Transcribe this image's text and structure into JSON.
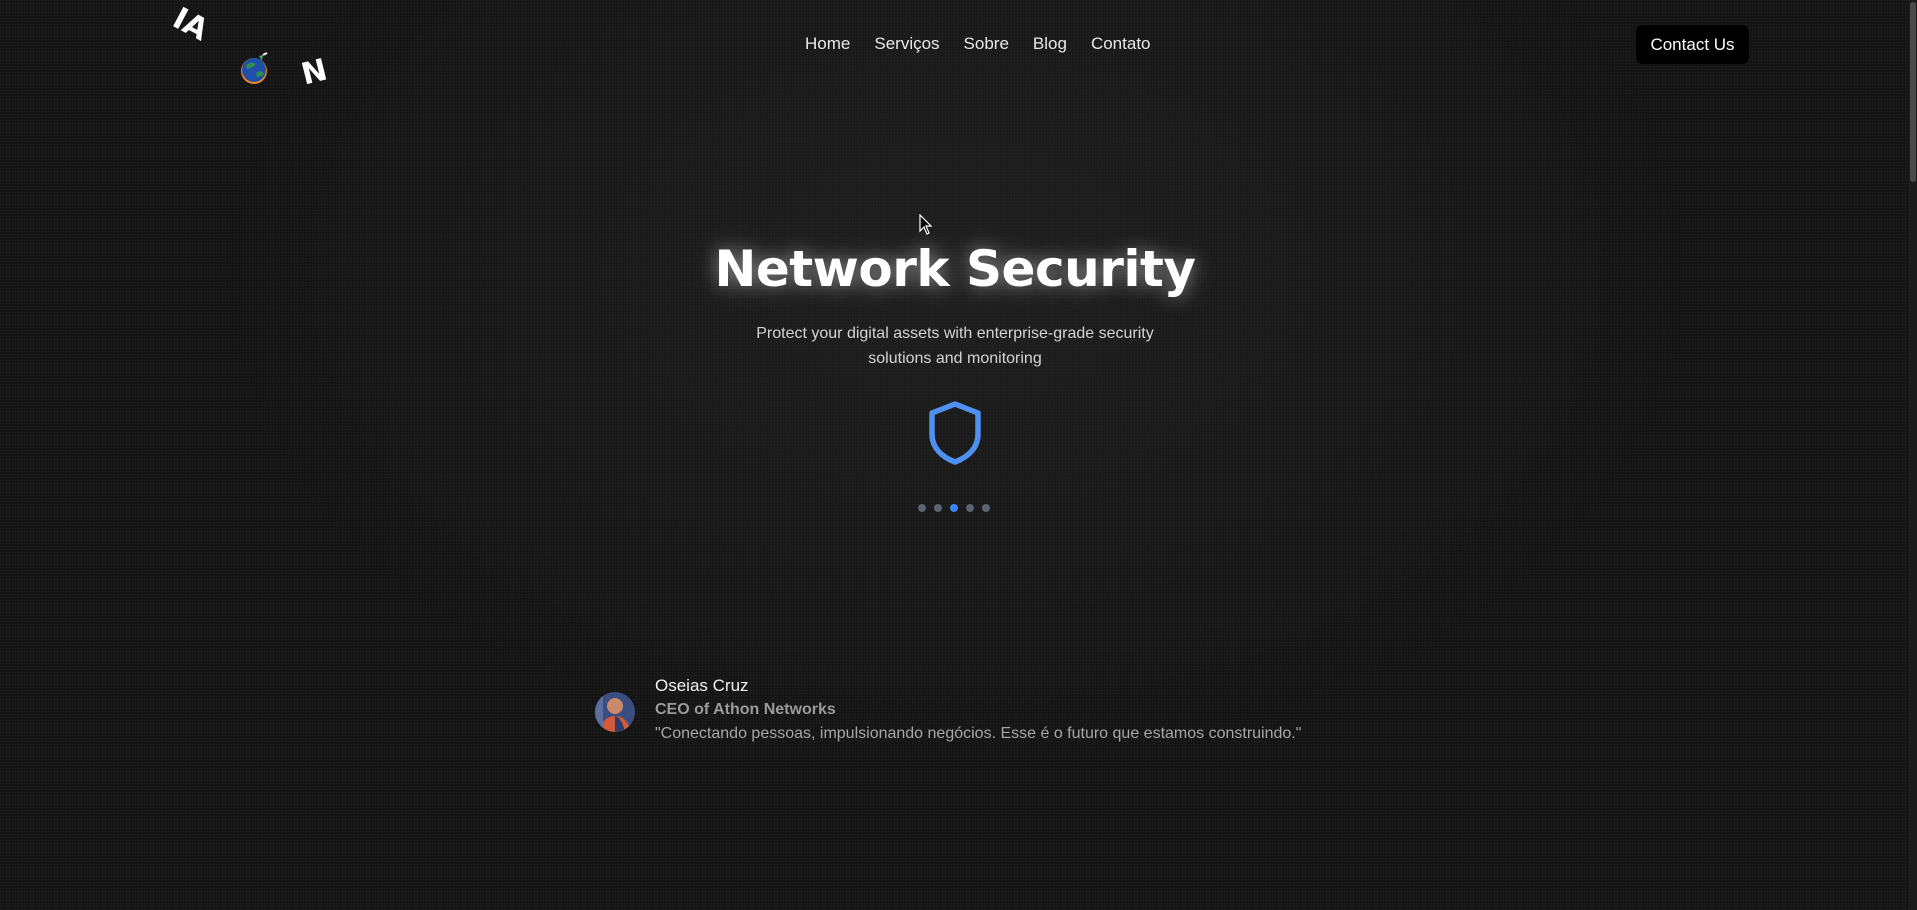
{
  "logo": {
    "letter_left": "IA",
    "letter_right": "N"
  },
  "nav": {
    "items": [
      {
        "label": "Home"
      },
      {
        "label": "Serviços"
      },
      {
        "label": "Sobre"
      },
      {
        "label": "Blog"
      },
      {
        "label": "Contato"
      }
    ],
    "contact_button": "Contact Us"
  },
  "hero": {
    "title": "Network Security",
    "subtitle": "Protect your digital assets with enterprise-grade security solutions and monitoring",
    "icon": "shield-icon",
    "slides_total": 5,
    "active_slide": 3
  },
  "testimonial": {
    "name": "Oseias Cruz",
    "role": "CEO of Athon Networks",
    "quote": "\"Conectando pessoas, impulsionando negócios. Esse é o futuro que estamos construindo.\""
  },
  "colors": {
    "background": "#131313",
    "accent": "#3b82f6",
    "dot_inactive": "#5c6370",
    "button_bg": "#000000"
  }
}
